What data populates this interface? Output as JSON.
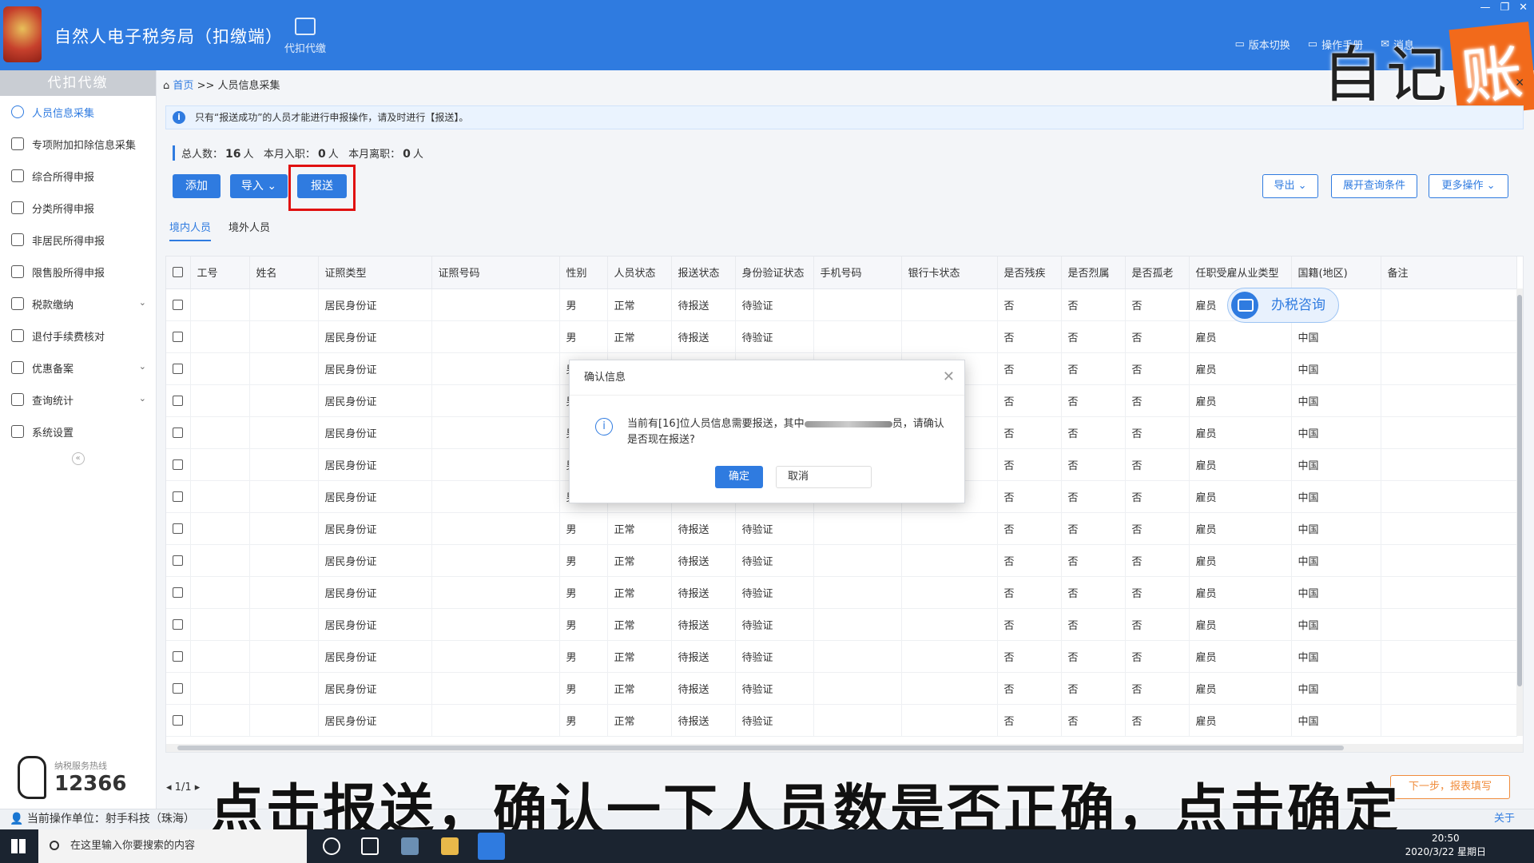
{
  "app": {
    "title": "自然人电子税务局（扣缴端）",
    "nav_label": "代扣代缴"
  },
  "top_links": [
    "版本切换",
    "操作手册",
    "消息"
  ],
  "watermark": {
    "text": "自记",
    "box": "账"
  },
  "sidebar": {
    "header": "代扣代缴",
    "items": [
      {
        "label": "人员信息采集",
        "icon": "person-icon",
        "active": true
      },
      {
        "label": "专项附加扣除信息采集",
        "icon": "list-icon"
      },
      {
        "label": "综合所得申报",
        "icon": "layers-icon"
      },
      {
        "label": "分类所得申报",
        "icon": "pie-icon"
      },
      {
        "label": "非居民所得申报",
        "icon": "person-icon"
      },
      {
        "label": "限售股所得申报",
        "icon": "bar-chart-icon"
      },
      {
        "label": "税款缴纳",
        "icon": "wallet-icon",
        "chev": true
      },
      {
        "label": "退付手续费核对",
        "icon": "document-icon"
      },
      {
        "label": "优惠备案",
        "icon": "file-icon",
        "chev": true
      },
      {
        "label": "查询统计",
        "icon": "query-icon",
        "chev": true
      },
      {
        "label": "系统设置",
        "icon": "gear-icon"
      }
    ],
    "hotline_label": "纳税服务热线",
    "hotline_number": "12366"
  },
  "breadcrumb": {
    "home": "首页",
    "sep": ">>",
    "current": "人员信息采集"
  },
  "notice": "只有“报送成功”的人员才能进行申报操作，请及时进行【报送】。",
  "stats": {
    "total_label": "总人数：",
    "total": "16",
    "unit": "人",
    "joined_label": "本月入职：",
    "joined": "0",
    "left_label": "本月离职：",
    "left": "0"
  },
  "toolbar": {
    "add": "添加",
    "import": "导入",
    "submit": "报送",
    "export": "导出",
    "expand": "展开查询条件",
    "more": "更多操作"
  },
  "tabs": [
    "境内人员",
    "境外人员"
  ],
  "table": {
    "headers": [
      "工号",
      "姓名",
      "证照类型",
      "证照号码",
      "性别",
      "人员状态",
      "报送状态",
      "身份验证状态",
      "手机号码",
      "银行卡状态",
      "是否残疾",
      "是否烈属",
      "是否孤老",
      "任职受雇从业类型",
      "国籍(地区)",
      "备注"
    ],
    "row": {
      "id_type": "居民身份证",
      "gender": "男",
      "status": "正常",
      "report": "待报送",
      "verify": "待验证",
      "no": "否",
      "employ": "雇员",
      "country": "中国"
    },
    "row_count": 14
  },
  "chat_button": "办税咨询",
  "modal": {
    "title": "确认信息",
    "message_pre": "当前有[16]位人员信息需要报送，其中",
    "message_post": "员，请确认是否现在报送?",
    "ok": "确定",
    "cancel": "取消"
  },
  "pager": "1/1",
  "next_button": "下一步，报表填写",
  "statusbar": {
    "unit_label": "当前操作单位：射手科技（珠海）",
    "about": "关于"
  },
  "subtitle": "点击报送，确认一下人员数是否正确，点击确定",
  "taskbar": {
    "search_placeholder": "在这里输入你要搜索的内容",
    "time": "20:50",
    "date": "2020/3/22 星期日"
  }
}
